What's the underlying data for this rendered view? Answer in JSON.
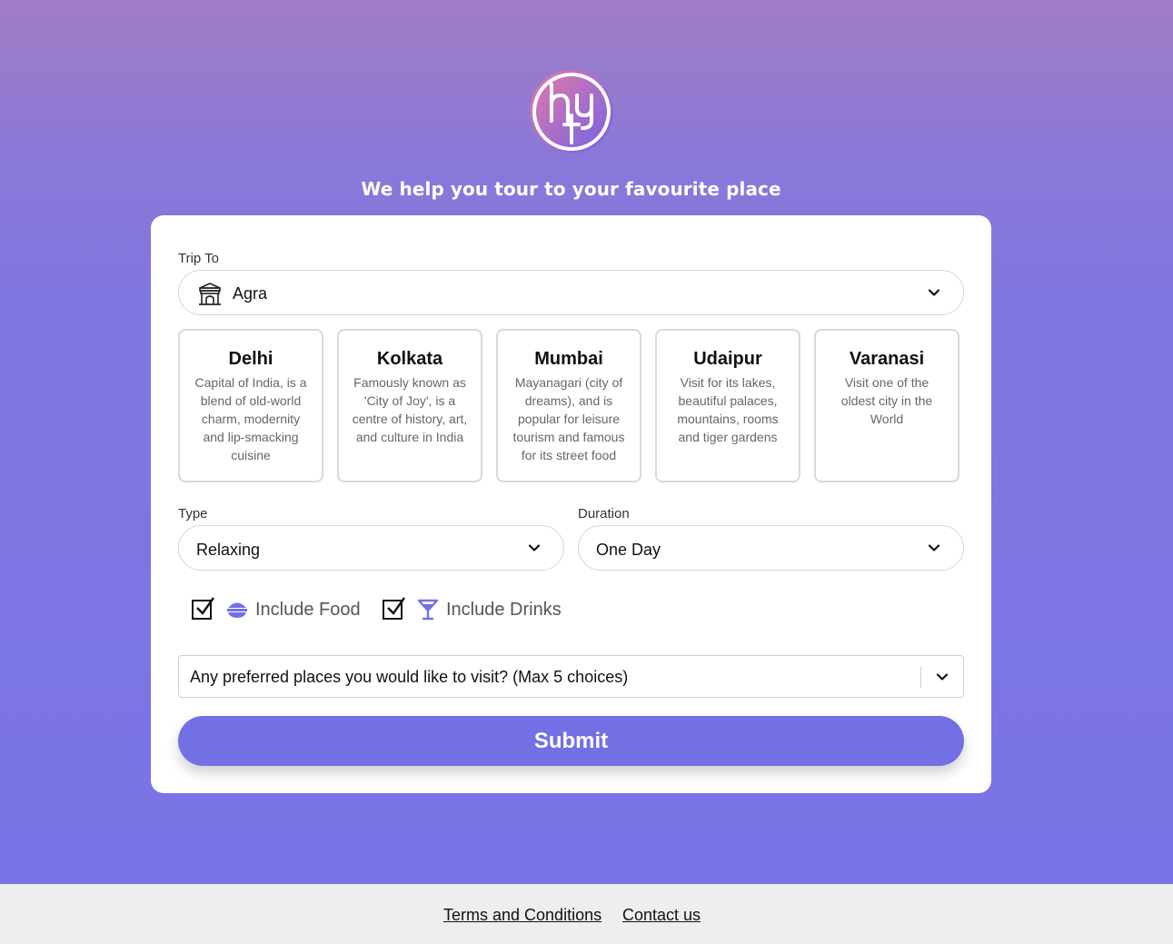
{
  "tagline": "We help you tour to your favourite place",
  "logo": {
    "letters": "hyt",
    "icon": "hyt-logo"
  },
  "trip": {
    "label": "Trip To",
    "value": "Agra",
    "icon": "india-gate-icon"
  },
  "cities": [
    {
      "name": "Delhi",
      "desc": "Capital of India, is a blend of old-world charm, modernity and lip-smacking cuisine"
    },
    {
      "name": "Kolkata",
      "desc": "Famously known as 'City of Joy', is a centre of history, art, and culture in India"
    },
    {
      "name": "Mumbai",
      "desc": "Mayanagari (city of dreams), and is popular for leisure tourism and famous for its street food"
    },
    {
      "name": "Udaipur",
      "desc": "Visit for its lakes, beautiful palaces, mountains, rooms and tiger gardens"
    },
    {
      "name": "Varanasi",
      "desc": "Visit one of the oldest city in the World"
    }
  ],
  "type": {
    "label": "Type",
    "value": "Relaxing"
  },
  "duration": {
    "label": "Duration",
    "value": "One Day"
  },
  "options": {
    "food": {
      "label": "Include Food",
      "checked": true,
      "icon": "food-bowl-icon"
    },
    "drinks": {
      "label": "Include Drinks",
      "checked": true,
      "icon": "cocktail-glass-icon"
    }
  },
  "places": {
    "placeholder": "Any preferred places you would like to visit? (Max 5 choices)"
  },
  "submit_label": "Submit",
  "footer": {
    "terms": "Terms and Conditions",
    "contact": "Contact us"
  },
  "colors": {
    "accent": "#7370e6",
    "gradient_top": "#a07dc4",
    "gradient_bottom": "#7a74e6",
    "footer_bg": "#eeeeee"
  }
}
